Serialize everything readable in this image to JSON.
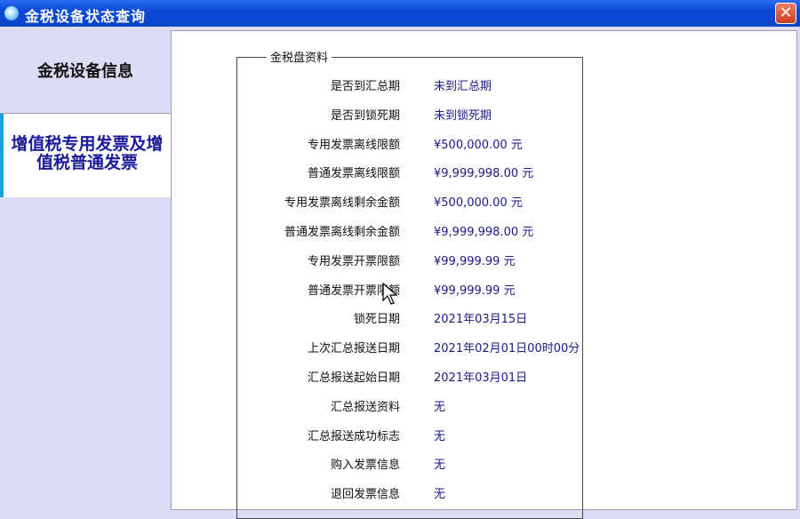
{
  "window": {
    "title": "金税设备状态查询",
    "close_label": "✕"
  },
  "tabs": [
    {
      "label": "金税设备信息"
    },
    {
      "label": "增值税专用发票及增值税普通发票"
    }
  ],
  "group": {
    "title": "金税盘资料"
  },
  "rows": [
    {
      "label": "是否到汇总期",
      "value": "未到汇总期"
    },
    {
      "label": "是否到锁死期",
      "value": "未到锁死期"
    },
    {
      "label": "专用发票离线限额",
      "value": "¥500,000.00 元"
    },
    {
      "label": "普通发票离线限额",
      "value": "¥9,999,998.00 元"
    },
    {
      "label": "专用发票离线剩余金额",
      "value": "¥500,000.00 元"
    },
    {
      "label": "普通发票离线剩余金额",
      "value": "¥9,999,998.00 元"
    },
    {
      "label": "专用发票开票限额",
      "value": "¥99,999.99 元"
    },
    {
      "label": "普通发票开票限额",
      "value": "¥99,999.99 元"
    },
    {
      "label": "锁死日期",
      "value": "2021年03月15日"
    },
    {
      "label": "上次汇总报送日期",
      "value": "2021年02月01日00时00分"
    },
    {
      "label": "汇总报送起始日期",
      "value": "2021年03月01日"
    },
    {
      "label": "汇总报送资料",
      "value": "无"
    },
    {
      "label": "汇总报送成功标志",
      "value": "无"
    },
    {
      "label": "购入发票信息",
      "value": "无"
    },
    {
      "label": "退回发票信息",
      "value": "无"
    }
  ]
}
